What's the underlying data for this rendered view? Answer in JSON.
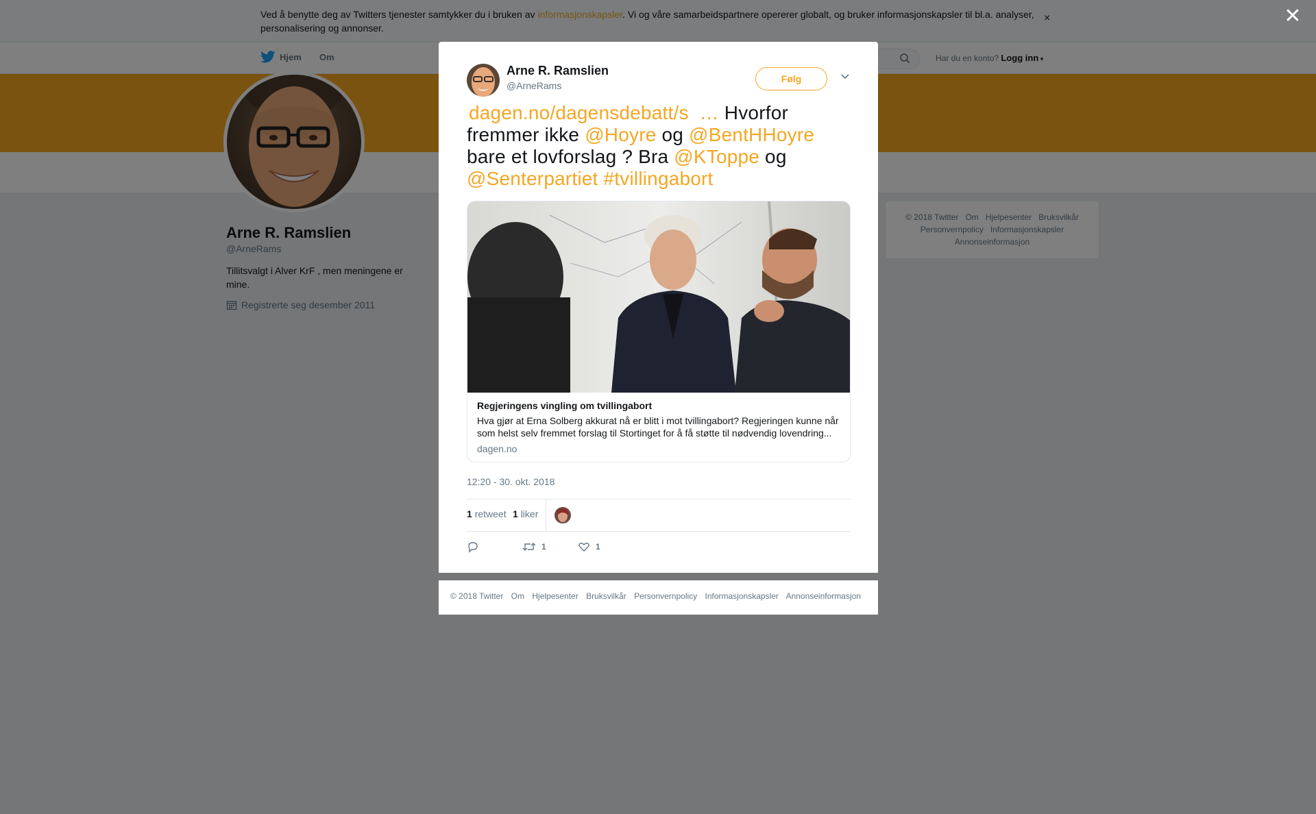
{
  "cookie": {
    "text_before": "Ved å benytte deg av Twitters tjenester samtykker du i bruken av ",
    "link": "informasjonskapsler",
    "text_after": ". Vi og våre samarbeidspartnere opererer globalt, og bruker informasjonskapsler til bl.a. analyser, personalisering og annonser.",
    "close": "×"
  },
  "nav": {
    "home": "Hjem",
    "about": "Om",
    "account_prompt": "Har du en konto?",
    "login": "Logg inn"
  },
  "profile": {
    "name": "Arne R. Ramslien",
    "handle": "@ArneRams",
    "bio": "Tillitsvalgt i Alver KrF , men meningene er mine.",
    "joined": "Registrerte seg desember 2011"
  },
  "side_footer": {
    "links": [
      "© 2018 Twitter",
      "Om",
      "Hjelpesenter",
      "Bruksvilkår",
      "Personvernpolicy",
      "Informasjonskapsler",
      "Annonseinformasjon"
    ]
  },
  "overlay": {
    "close": "✕"
  },
  "tweet": {
    "author_name": "Arne R. Ramslien",
    "author_handle": "@ArneRams",
    "follow_label": "Følg",
    "text": {
      "url": "dagen.no/dagensdebatt/s",
      "ellipsis": "…",
      "part1": " Hvorfor fremmer ikke ",
      "mention1": "@Hoyre",
      "part2": "  og ",
      "mention2": "@BentHHoyre",
      "part3": " bare et lovforslag ? Bra ",
      "mention3": "@KToppe",
      "part4": " og ",
      "mention4": "@Senterpartiet",
      "hashtag": "#tvillingabort"
    },
    "card": {
      "title": "Regjeringens vingling om tvillingabort",
      "description": "Hva gjør at Erna Solberg akkurat nå er blitt i mot tvillingabort? Regjeringen kunne når som helst selv fremmet forslag til Stortinget for å få støtte til nødvendig lovendring...",
      "domain": "dagen.no"
    },
    "timestamp": "12:20 - 30. okt. 2018",
    "retweets_count": "1",
    "retweets_label": "retweet",
    "likes_count": "1",
    "likes_label": "liker",
    "action_retweet_count": "1",
    "action_like_count": "1"
  },
  "modal_footer": {
    "links": [
      "© 2018 Twitter",
      "Om",
      "Hjelpesenter",
      "Bruksvilkår",
      "Personvernpolicy",
      "Informasjonskapsler",
      "Annonseinformasjon"
    ]
  },
  "colors": {
    "accent": "#f5a623",
    "text": "#14171a",
    "muted": "#657786"
  }
}
